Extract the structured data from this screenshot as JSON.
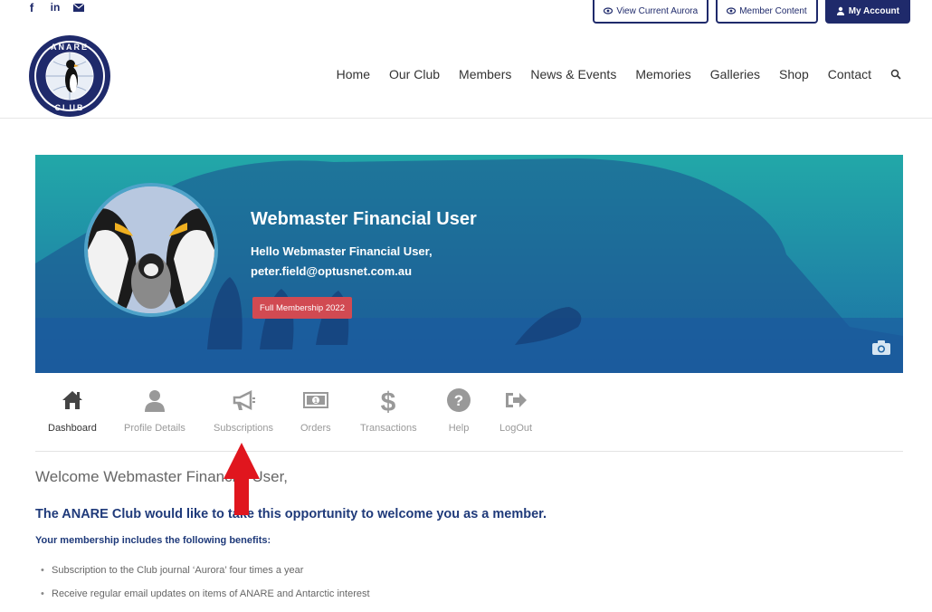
{
  "top_buttons": {
    "view_aurora": "View Current Aurora",
    "member_content": "Member Content",
    "my_account": "My Account"
  },
  "logo": {
    "top_text": "ANARE",
    "bottom_text": "CLUB"
  },
  "nav": [
    "Home",
    "Our Club",
    "Members",
    "News & Events",
    "Memories",
    "Galleries",
    "Shop",
    "Contact"
  ],
  "profile": {
    "display_name": "Webmaster Financial User",
    "greeting": "Hello Webmaster Financial User,",
    "email": "peter.field@optusnet.com.au",
    "membership_badge": "Full Membership 2022"
  },
  "tabs": {
    "dashboard": "Dashboard",
    "profile_details": "Profile Details",
    "subscriptions": "Subscriptions",
    "orders": "Orders",
    "transactions": "Transactions",
    "help": "Help",
    "logout": "LogOut"
  },
  "content": {
    "welcome": "Welcome Webmaster Financial User,",
    "intro": "The ANARE Club would like to take this opportunity to welcome you as a member.",
    "benefits_heading": "Your membership includes the following benefits:",
    "benefits": [
      "Subscription to the Club journal ‘Aurora’ four times a year",
      "Receive regular email updates on items of ANARE and Antarctic interest"
    ]
  },
  "colors": {
    "brand_navy": "#1f2a6b",
    "badge_red": "#d14a52",
    "arrow_red": "#e0161e"
  }
}
